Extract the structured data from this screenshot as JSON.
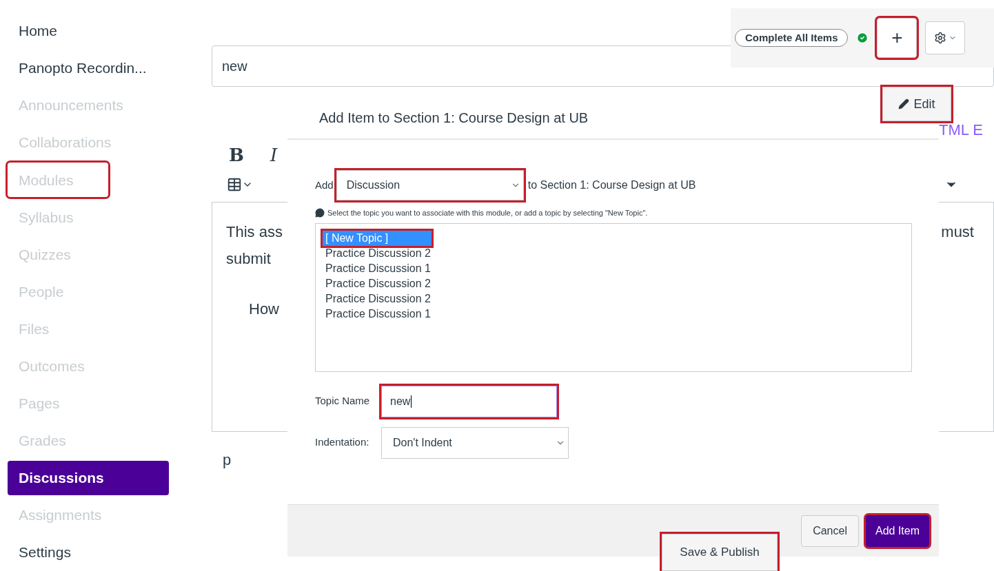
{
  "sidebar": {
    "items": [
      {
        "label": "Home",
        "muted": false,
        "selected": false,
        "highlighted": false
      },
      {
        "label": "Panopto Recordin...",
        "muted": false,
        "selected": false,
        "highlighted": false
      },
      {
        "label": "Announcements",
        "muted": true,
        "selected": false,
        "highlighted": false
      },
      {
        "label": "Collaborations",
        "muted": true,
        "selected": false,
        "highlighted": false
      },
      {
        "label": "Modules",
        "muted": true,
        "selected": false,
        "highlighted": true
      },
      {
        "label": "Syllabus",
        "muted": true,
        "selected": false,
        "highlighted": false
      },
      {
        "label": "Quizzes",
        "muted": true,
        "selected": false,
        "highlighted": false
      },
      {
        "label": "People",
        "muted": true,
        "selected": false,
        "highlighted": false
      },
      {
        "label": "Files",
        "muted": true,
        "selected": false,
        "highlighted": false
      },
      {
        "label": "Outcomes",
        "muted": true,
        "selected": false,
        "highlighted": false
      },
      {
        "label": "Pages",
        "muted": true,
        "selected": false,
        "highlighted": false
      },
      {
        "label": "Grades",
        "muted": true,
        "selected": false,
        "highlighted": false
      },
      {
        "label": "Discussions",
        "muted": false,
        "selected": true,
        "highlighted": false
      },
      {
        "label": "Assignments",
        "muted": true,
        "selected": false,
        "highlighted": false
      },
      {
        "label": "Settings",
        "muted": false,
        "selected": false,
        "highlighted": false
      }
    ]
  },
  "editor": {
    "title_value": "new",
    "bold": "B",
    "italic": "I",
    "link_text": "TML E",
    "body_lines": [
      "This ass",
      "submit",
      "How"
    ],
    "body_right": "must",
    "below": "p"
  },
  "module_toolbar": {
    "complete_button": "Complete All Items",
    "add_button": {
      "label": "+",
      "highlighted": true
    },
    "edit_button": {
      "label": "Edit",
      "highlighted": true
    }
  },
  "dialog": {
    "title": "Add Item to Section 1: Course Design at UB",
    "add_label": "Add",
    "type_select": {
      "value": "Discussion",
      "highlighted": true
    },
    "target": "to Section 1: Course Design at UB",
    "hint": "Select the topic you want to associate with this module, or add a topic by selecting \"New Topic\".",
    "topics": [
      {
        "label": "[ New Topic ]",
        "selected": true,
        "highlighted": true
      },
      {
        "label": "Practice Discussion 2",
        "selected": false,
        "highlighted": false
      },
      {
        "label": "Practice Discussion 1",
        "selected": false,
        "highlighted": false
      },
      {
        "label": "Practice Discussion 2",
        "selected": false,
        "highlighted": false
      },
      {
        "label": "Practice Discussion 2",
        "selected": false,
        "highlighted": false
      },
      {
        "label": "Practice Discussion 1",
        "selected": false,
        "highlighted": false
      }
    ],
    "topic_name": {
      "label": "Topic Name",
      "value": "new",
      "highlighted": true
    },
    "indentation": {
      "label": "Indentation:",
      "value": "Don't Indent"
    },
    "cancel": "Cancel",
    "add_item": {
      "label": "Add Item",
      "highlighted": true
    }
  },
  "save_publish": {
    "label": "Save & Publish",
    "highlighted": true
  }
}
